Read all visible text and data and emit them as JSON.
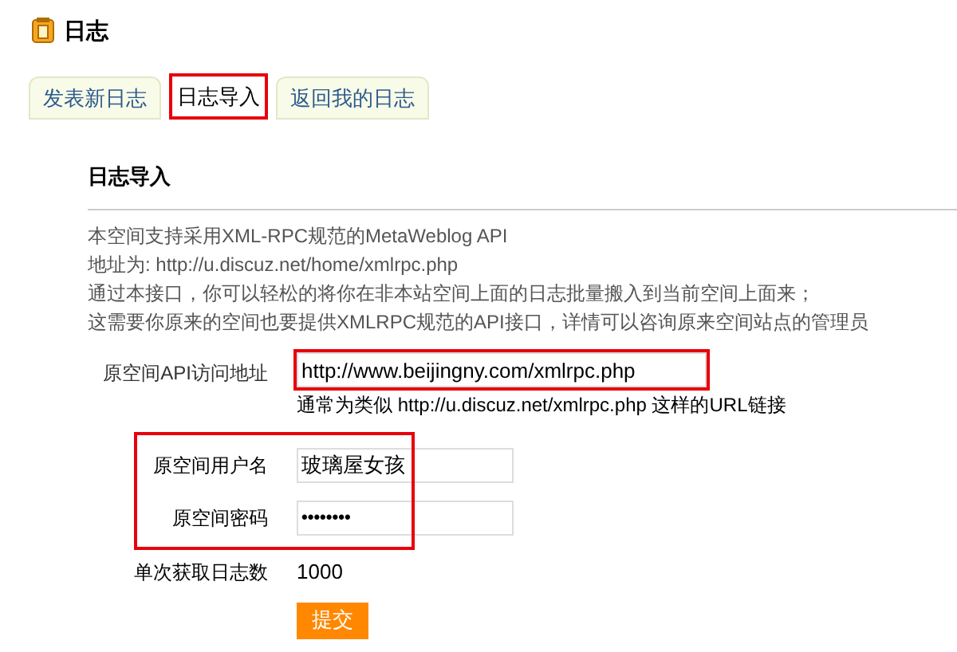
{
  "page_title": "日志",
  "tabs": [
    {
      "label": "发表新日志",
      "selected": false,
      "highlighted": false
    },
    {
      "label": "日志导入",
      "selected": true,
      "highlighted": true
    },
    {
      "label": "返回我的日志",
      "selected": false,
      "highlighted": false
    }
  ],
  "section_title": "日志导入",
  "intro_lines": [
    "本空间支持采用XML-RPC规范的MetaWeblog API",
    "地址为: http://u.discuz.net/home/xmlrpc.php",
    "通过本接口，你可以轻松的将你在非本站空间上面的日志批量搬入到当前空间上面来；",
    "这需要你原来的空间也要提供XMLRPC规范的API接口，详情可以咨询原来空间站点的管理员"
  ],
  "api_field": {
    "label": "原空间API访问地址",
    "value": "http://www.beijingny.com/xmlrpc.php",
    "hint": "通常为类似  http://u.discuz.net/xmlrpc.php 这样的URL链接",
    "highlighted": true
  },
  "credentials": {
    "highlighted": true,
    "fields": [
      {
        "label": "原空间用户名",
        "value": "玻璃屋女孩",
        "kind": "text"
      },
      {
        "label": "原空间密码",
        "value": "••••••••",
        "kind": "password"
      }
    ]
  },
  "fetch_count": {
    "label": "单次获取日志数",
    "value": "1000"
  },
  "submit_button": "提交"
}
